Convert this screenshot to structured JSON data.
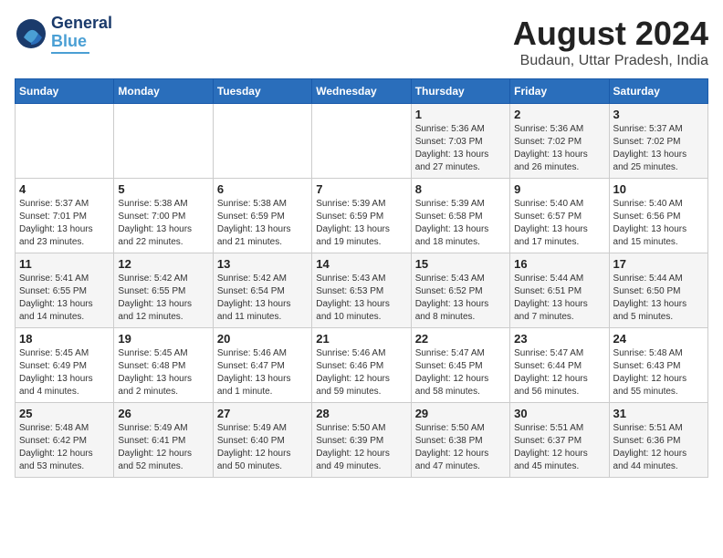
{
  "logo": {
    "line1": "General",
    "line2": "Blue"
  },
  "title": {
    "month_year": "August 2024",
    "location": "Budaun, Uttar Pradesh, India"
  },
  "weekdays": [
    "Sunday",
    "Monday",
    "Tuesday",
    "Wednesday",
    "Thursday",
    "Friday",
    "Saturday"
  ],
  "weeks": [
    [
      {
        "day": "",
        "info": ""
      },
      {
        "day": "",
        "info": ""
      },
      {
        "day": "",
        "info": ""
      },
      {
        "day": "",
        "info": ""
      },
      {
        "day": "1",
        "info": "Sunrise: 5:36 AM\nSunset: 7:03 PM\nDaylight: 13 hours\nand 27 minutes."
      },
      {
        "day": "2",
        "info": "Sunrise: 5:36 AM\nSunset: 7:02 PM\nDaylight: 13 hours\nand 26 minutes."
      },
      {
        "day": "3",
        "info": "Sunrise: 5:37 AM\nSunset: 7:02 PM\nDaylight: 13 hours\nand 25 minutes."
      }
    ],
    [
      {
        "day": "4",
        "info": "Sunrise: 5:37 AM\nSunset: 7:01 PM\nDaylight: 13 hours\nand 23 minutes."
      },
      {
        "day": "5",
        "info": "Sunrise: 5:38 AM\nSunset: 7:00 PM\nDaylight: 13 hours\nand 22 minutes."
      },
      {
        "day": "6",
        "info": "Sunrise: 5:38 AM\nSunset: 6:59 PM\nDaylight: 13 hours\nand 21 minutes."
      },
      {
        "day": "7",
        "info": "Sunrise: 5:39 AM\nSunset: 6:59 PM\nDaylight: 13 hours\nand 19 minutes."
      },
      {
        "day": "8",
        "info": "Sunrise: 5:39 AM\nSunset: 6:58 PM\nDaylight: 13 hours\nand 18 minutes."
      },
      {
        "day": "9",
        "info": "Sunrise: 5:40 AM\nSunset: 6:57 PM\nDaylight: 13 hours\nand 17 minutes."
      },
      {
        "day": "10",
        "info": "Sunrise: 5:40 AM\nSunset: 6:56 PM\nDaylight: 13 hours\nand 15 minutes."
      }
    ],
    [
      {
        "day": "11",
        "info": "Sunrise: 5:41 AM\nSunset: 6:55 PM\nDaylight: 13 hours\nand 14 minutes."
      },
      {
        "day": "12",
        "info": "Sunrise: 5:42 AM\nSunset: 6:55 PM\nDaylight: 13 hours\nand 12 minutes."
      },
      {
        "day": "13",
        "info": "Sunrise: 5:42 AM\nSunset: 6:54 PM\nDaylight: 13 hours\nand 11 minutes."
      },
      {
        "day": "14",
        "info": "Sunrise: 5:43 AM\nSunset: 6:53 PM\nDaylight: 13 hours\nand 10 minutes."
      },
      {
        "day": "15",
        "info": "Sunrise: 5:43 AM\nSunset: 6:52 PM\nDaylight: 13 hours\nand 8 minutes."
      },
      {
        "day": "16",
        "info": "Sunrise: 5:44 AM\nSunset: 6:51 PM\nDaylight: 13 hours\nand 7 minutes."
      },
      {
        "day": "17",
        "info": "Sunrise: 5:44 AM\nSunset: 6:50 PM\nDaylight: 13 hours\nand 5 minutes."
      }
    ],
    [
      {
        "day": "18",
        "info": "Sunrise: 5:45 AM\nSunset: 6:49 PM\nDaylight: 13 hours\nand 4 minutes."
      },
      {
        "day": "19",
        "info": "Sunrise: 5:45 AM\nSunset: 6:48 PM\nDaylight: 13 hours\nand 2 minutes."
      },
      {
        "day": "20",
        "info": "Sunrise: 5:46 AM\nSunset: 6:47 PM\nDaylight: 13 hours\nand 1 minute."
      },
      {
        "day": "21",
        "info": "Sunrise: 5:46 AM\nSunset: 6:46 PM\nDaylight: 12 hours\nand 59 minutes."
      },
      {
        "day": "22",
        "info": "Sunrise: 5:47 AM\nSunset: 6:45 PM\nDaylight: 12 hours\nand 58 minutes."
      },
      {
        "day": "23",
        "info": "Sunrise: 5:47 AM\nSunset: 6:44 PM\nDaylight: 12 hours\nand 56 minutes."
      },
      {
        "day": "24",
        "info": "Sunrise: 5:48 AM\nSunset: 6:43 PM\nDaylight: 12 hours\nand 55 minutes."
      }
    ],
    [
      {
        "day": "25",
        "info": "Sunrise: 5:48 AM\nSunset: 6:42 PM\nDaylight: 12 hours\nand 53 minutes."
      },
      {
        "day": "26",
        "info": "Sunrise: 5:49 AM\nSunset: 6:41 PM\nDaylight: 12 hours\nand 52 minutes."
      },
      {
        "day": "27",
        "info": "Sunrise: 5:49 AM\nSunset: 6:40 PM\nDaylight: 12 hours\nand 50 minutes."
      },
      {
        "day": "28",
        "info": "Sunrise: 5:50 AM\nSunset: 6:39 PM\nDaylight: 12 hours\nand 49 minutes."
      },
      {
        "day": "29",
        "info": "Sunrise: 5:50 AM\nSunset: 6:38 PM\nDaylight: 12 hours\nand 47 minutes."
      },
      {
        "day": "30",
        "info": "Sunrise: 5:51 AM\nSunset: 6:37 PM\nDaylight: 12 hours\nand 45 minutes."
      },
      {
        "day": "31",
        "info": "Sunrise: 5:51 AM\nSunset: 6:36 PM\nDaylight: 12 hours\nand 44 minutes."
      }
    ]
  ]
}
